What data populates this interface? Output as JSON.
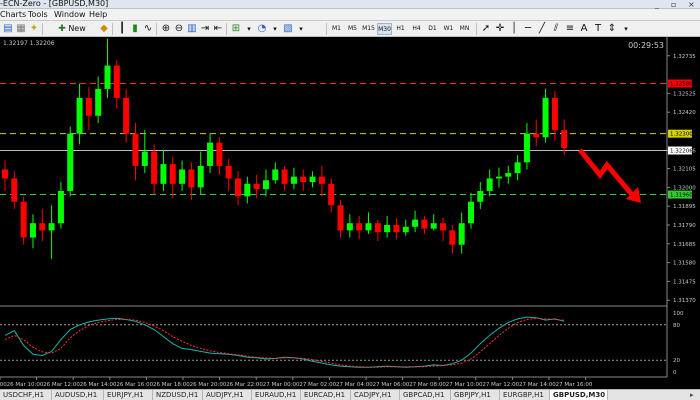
{
  "window": {
    "title": "-ECN-Zero - [GBPUSD,M30]",
    "controls": [
      "_",
      "▫",
      "×"
    ]
  },
  "menu": [
    "Charts",
    "Tools",
    "Window",
    "Help"
  ],
  "toolbar": {
    "new_order": "New Order",
    "timeframes": [
      "M1",
      "M5",
      "M15",
      "M30",
      "H1",
      "H4",
      "D1",
      "W1",
      "MN"
    ],
    "active_timeframe": "M30"
  },
  "chart": {
    "symbol_info": "1.32197 1.32206",
    "clock": "00:29:53",
    "price_labels": [
      "1.32735",
      "1.32525",
      "1.32420",
      "1.32206",
      "1.32105",
      "1.32000",
      "1.31895",
      "1.31790",
      "1.31685",
      "1.31580",
      "1.31475",
      "1.31370"
    ],
    "marker_labels": [
      {
        "text": "1.32580",
        "bg": "#ff0000",
        "color": "#000"
      },
      {
        "text": "1.32300",
        "bg": "#d4d400",
        "color": "#000"
      },
      {
        "text": "1.32206",
        "bg": "#ffffff",
        "color": "#000"
      },
      {
        "text": "1.31960",
        "bg": "#33cc33",
        "color": "#000"
      }
    ],
    "stoch_labels": [
      "100",
      "80",
      "20",
      "0"
    ],
    "time_labels": [
      "26 Mar 08:00",
      "26 Mar 10:00",
      "26 Mar 12:00",
      "26 Mar 14:00",
      "26 Mar 16:00",
      "26 Mar 18:00",
      "26 Mar 20:00",
      "26 Mar 22:00",
      "27 Mar 00:00",
      "27 Mar 02:00",
      "27 Mar 04:00",
      "27 Mar 06:00",
      "27 Mar 08:00",
      "27 Mar 10:00",
      "27 Mar 12:00",
      "27 Mar 14:00",
      "27 Mar 16:00"
    ],
    "colors": {
      "bull": "#00ff00",
      "bear": "#ff0000",
      "grid": "#3a3a3a",
      "axis_text": "#c8c8c8"
    },
    "candles": [
      [
        1.321,
        1.3205,
        1.3215,
        1.3198
      ],
      [
        1.3205,
        1.3192,
        1.3209,
        1.3188
      ],
      [
        1.3192,
        1.3172,
        1.3195,
        1.3168
      ],
      [
        1.3172,
        1.318,
        1.3185,
        1.3166
      ],
      [
        1.318,
        1.3176,
        1.3188,
        1.317
      ],
      [
        1.3176,
        1.318,
        1.319,
        1.316
      ],
      [
        1.318,
        1.3198,
        1.3203,
        1.3177
      ],
      [
        1.3198,
        1.323,
        1.3234,
        1.3195
      ],
      [
        1.323,
        1.325,
        1.3258,
        1.3224
      ],
      [
        1.325,
        1.324,
        1.3256,
        1.3232
      ],
      [
        1.324,
        1.3255,
        1.3262,
        1.3236
      ],
      [
        1.3255,
        1.3268,
        1.3283,
        1.325
      ],
      [
        1.3268,
        1.325,
        1.3271,
        1.3244
      ],
      [
        1.325,
        1.323,
        1.3255,
        1.3225
      ],
      [
        1.323,
        1.3212,
        1.3236,
        1.3204
      ],
      [
        1.3212,
        1.322,
        1.3232,
        1.3208
      ],
      [
        1.322,
        1.3202,
        1.3224,
        1.3196
      ],
      [
        1.3202,
        1.3213,
        1.3221,
        1.3198
      ],
      [
        1.3213,
        1.3202,
        1.3217,
        1.3194
      ],
      [
        1.3202,
        1.321,
        1.3215,
        1.3198
      ],
      [
        1.321,
        1.32,
        1.3214,
        1.3193
      ],
      [
        1.32,
        1.3212,
        1.322,
        1.3196
      ],
      [
        1.3212,
        1.3225,
        1.323,
        1.3208
      ],
      [
        1.3225,
        1.3212,
        1.3228,
        1.3207
      ],
      [
        1.3212,
        1.3205,
        1.3216,
        1.3198
      ],
      [
        1.3205,
        1.3195,
        1.3209,
        1.319
      ],
      [
        1.3195,
        1.3202,
        1.3206,
        1.3191
      ],
      [
        1.3202,
        1.3199,
        1.3207,
        1.3194
      ],
      [
        1.3199,
        1.3204,
        1.321,
        1.3195
      ],
      [
        1.3204,
        1.321,
        1.3214,
        1.3202
      ],
      [
        1.321,
        1.3202,
        1.3212,
        1.3198
      ],
      [
        1.3202,
        1.3206,
        1.3211,
        1.3199
      ],
      [
        1.3206,
        1.3203,
        1.321,
        1.3198
      ],
      [
        1.3203,
        1.3206,
        1.3209,
        1.32
      ],
      [
        1.3206,
        1.3202,
        1.3212,
        1.3195
      ],
      [
        1.3202,
        1.319,
        1.3205,
        1.3186
      ],
      [
        1.319,
        1.3176,
        1.3193,
        1.3172
      ],
      [
        1.3176,
        1.318,
        1.3185,
        1.3172
      ],
      [
        1.318,
        1.3176,
        1.3184,
        1.3171
      ],
      [
        1.3176,
        1.318,
        1.3186,
        1.3174
      ],
      [
        1.318,
        1.3175,
        1.3182,
        1.317
      ],
      [
        1.3175,
        1.3179,
        1.3184,
        1.3172
      ],
      [
        1.3179,
        1.3175,
        1.3183,
        1.3171
      ],
      [
        1.3175,
        1.3178,
        1.3182,
        1.3173
      ],
      [
        1.3178,
        1.3182,
        1.3187,
        1.3175
      ],
      [
        1.3182,
        1.3177,
        1.3184,
        1.3174
      ],
      [
        1.3177,
        1.318,
        1.3185,
        1.3176
      ],
      [
        1.318,
        1.3176,
        1.3183,
        1.317
      ],
      [
        1.3176,
        1.3168,
        1.3179,
        1.3163
      ],
      [
        1.3168,
        1.318,
        1.3186,
        1.3163
      ],
      [
        1.318,
        1.3192,
        1.3197,
        1.3177
      ],
      [
        1.3192,
        1.3198,
        1.3203,
        1.3188
      ],
      [
        1.3198,
        1.3205,
        1.321,
        1.3195
      ],
      [
        1.3205,
        1.3206,
        1.3211,
        1.32
      ],
      [
        1.3206,
        1.3208,
        1.3212,
        1.3202
      ],
      [
        1.3208,
        1.3214,
        1.3218,
        1.3204
      ],
      [
        1.3214,
        1.323,
        1.3236,
        1.321
      ],
      [
        1.323,
        1.3228,
        1.3238,
        1.3223
      ],
      [
        1.3228,
        1.325,
        1.3255,
        1.3225
      ],
      [
        1.325,
        1.3232,
        1.3254,
        1.3226
      ],
      [
        1.3232,
        1.3222,
        1.3238,
        1.3218
      ]
    ],
    "stoch_main": [
      62,
      70,
      45,
      30,
      28,
      35,
      55,
      72,
      80,
      85,
      88,
      90,
      91,
      89,
      86,
      80,
      72,
      60,
      48,
      40,
      38,
      35,
      32,
      31,
      30,
      28,
      25,
      24,
      22,
      23,
      25,
      24,
      22,
      18,
      15,
      12,
      10,
      9,
      8,
      8,
      9,
      10,
      9,
      8,
      9,
      10,
      12,
      11,
      14,
      20,
      32,
      48,
      62,
      74,
      84,
      90,
      93,
      92,
      88,
      90,
      86
    ],
    "stoch_signal": [
      55,
      62,
      55,
      42,
      34,
      32,
      40,
      58,
      70,
      79,
      84,
      87,
      89,
      89,
      88,
      84,
      78,
      70,
      60,
      52,
      45,
      40,
      36,
      33,
      31,
      29,
      27,
      25,
      24,
      23,
      24,
      24,
      23,
      21,
      18,
      15,
      12,
      10,
      9,
      8,
      8,
      9,
      9,
      9,
      9,
      9,
      10,
      11,
      12,
      15,
      22,
      34,
      48,
      62,
      74,
      84,
      89,
      91,
      90,
      89,
      88
    ]
  },
  "tabs": [
    "USDCHF,H1",
    "AUDUSD,H1",
    "EURJPY,H1",
    "NZDUSD,H1",
    "AUDJPY,H1",
    "EURAUD,H1",
    "EURCAD,H1",
    "CADJPY,H1",
    "GBPCAD,H1",
    "GBPJPY,H1",
    "EURGBP,H1",
    "GBPUSD,M30"
  ],
  "active_tab": "GBPUSD,M30"
}
